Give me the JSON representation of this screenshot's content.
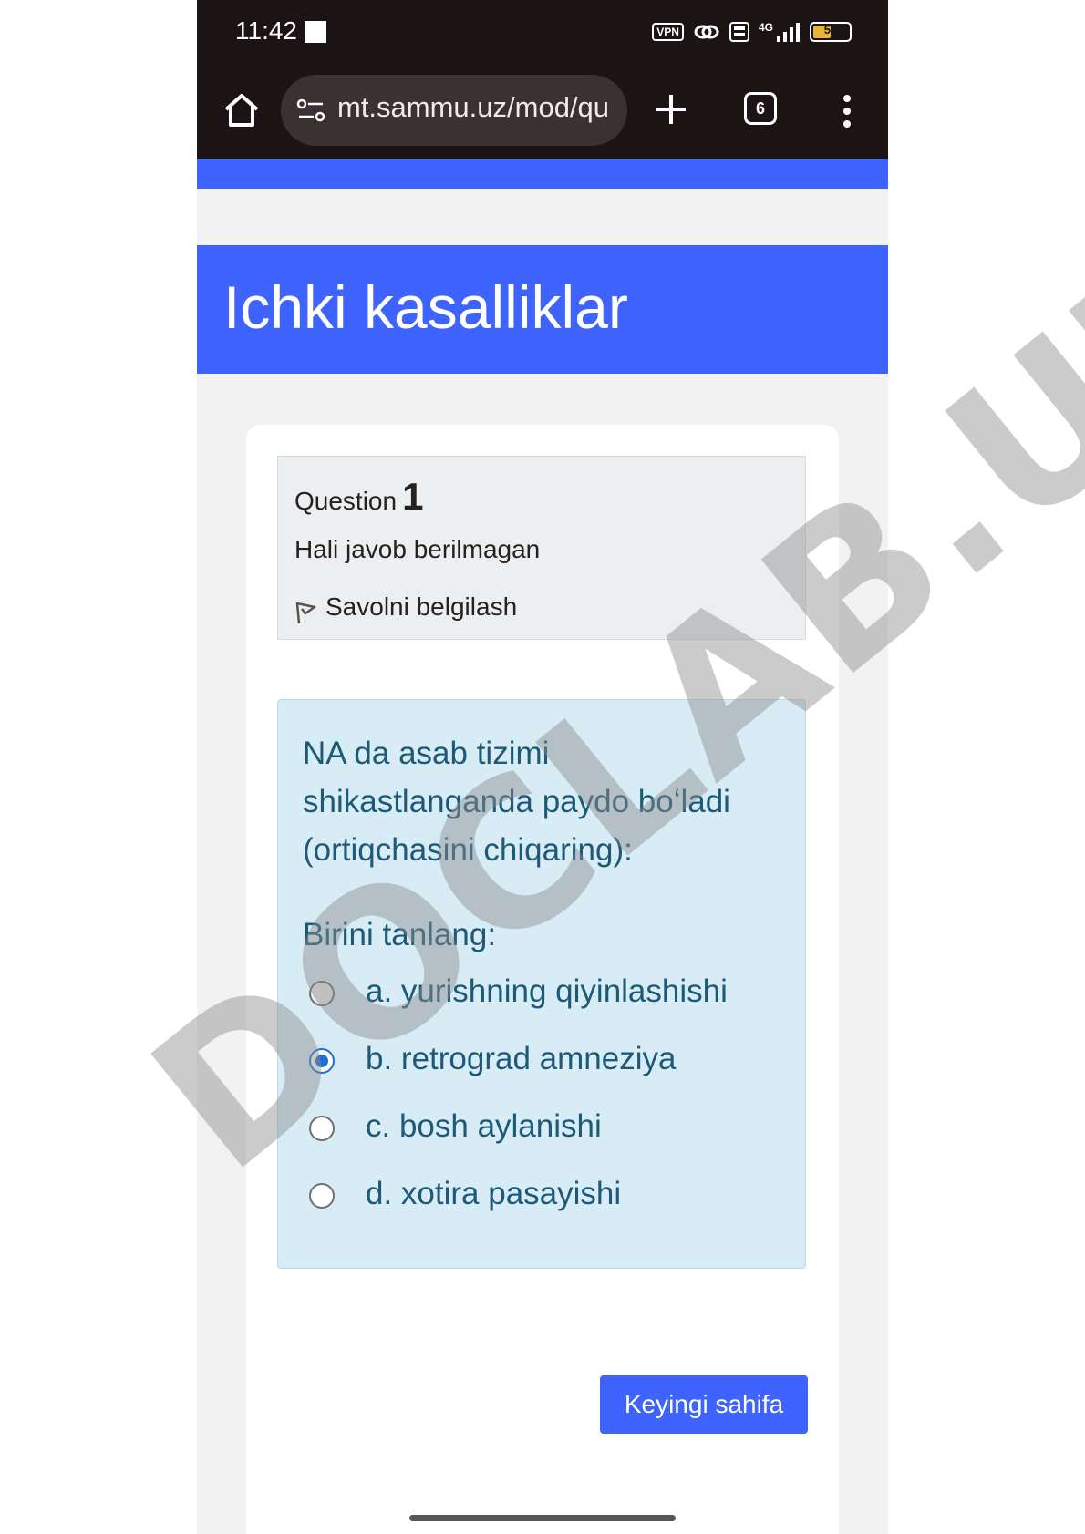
{
  "status_bar": {
    "time": "11:42",
    "vpn": "VPN",
    "network": "4G",
    "battery": "55"
  },
  "browser": {
    "url": "mt.sammu.uz/mod/qu",
    "tab_count": "6"
  },
  "course": {
    "title": "Ichki kasalliklar"
  },
  "question_info": {
    "label": "Question",
    "number": "1",
    "state": "Hali javob berilmagan",
    "flag_label": "Savolni belgilash"
  },
  "question": {
    "text": "NA da asab tizimi shikastlanganda paydo boʻladi (ortiqchasini chiqaring):",
    "prompt": "Birini tanlang:",
    "answers": [
      {
        "label": "a. yurishning qiyinlashishi",
        "selected": false
      },
      {
        "label": "b. retrograd amneziya",
        "selected": true
      },
      {
        "label": "c. bosh aylanishi",
        "selected": false
      },
      {
        "label": "d. xotira pasayishi",
        "selected": false
      }
    ]
  },
  "navigation": {
    "next_label": "Keyingi sahifa"
  },
  "watermark": "DOCLAB.UZ",
  "colors": {
    "accent": "#3e63ff",
    "info_bg": "#d8ecf6",
    "info_text": "#1d5a78",
    "radio_checked": "#1a6fd8"
  }
}
